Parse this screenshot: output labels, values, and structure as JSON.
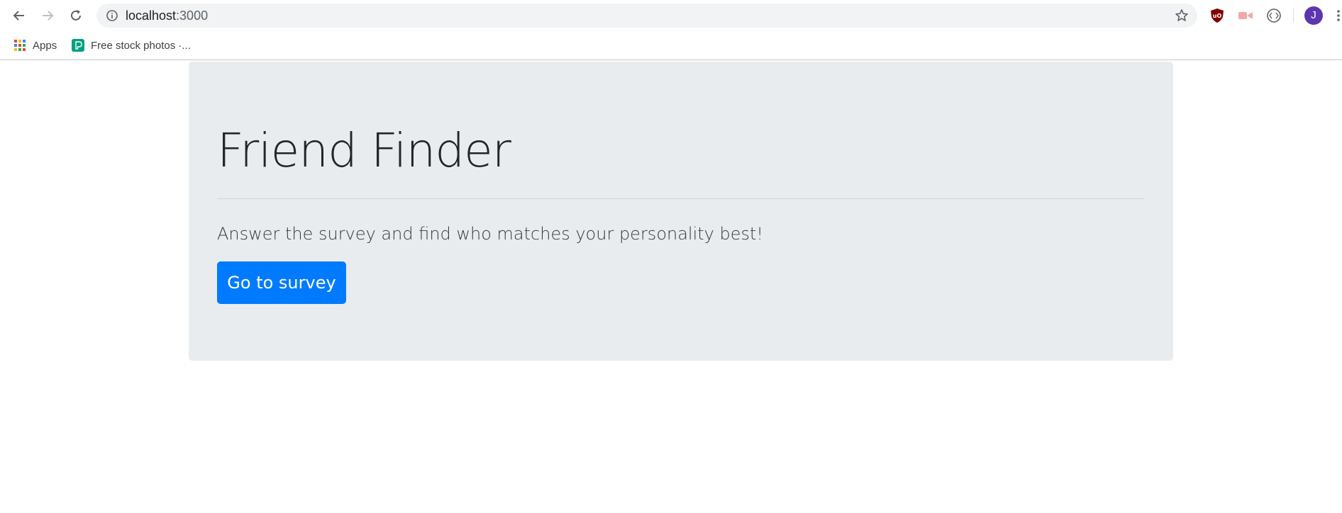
{
  "browser": {
    "url_host": "localhost",
    "url_port": ":3000",
    "profile_initial": "J",
    "icons": [
      "back-icon",
      "forward-icon",
      "reload-icon",
      "info-icon",
      "star-icon",
      "ublock-icon",
      "extension-icon",
      "code-icon",
      "menu-icon"
    ]
  },
  "bookmarks": [
    {
      "label": "Apps",
      "icon": "apps-grid-icon"
    },
    {
      "label": "Free stock photos ·...",
      "icon": "pexels-icon"
    }
  ],
  "page": {
    "title": "Friend Finder",
    "lead": "Answer the survey and find who matches your personality best!",
    "button_label": "Go to survey"
  },
  "colors": {
    "jumbotron_bg": "#e9ecef",
    "primary": "#007bff",
    "avatar": "#5e35b1"
  }
}
